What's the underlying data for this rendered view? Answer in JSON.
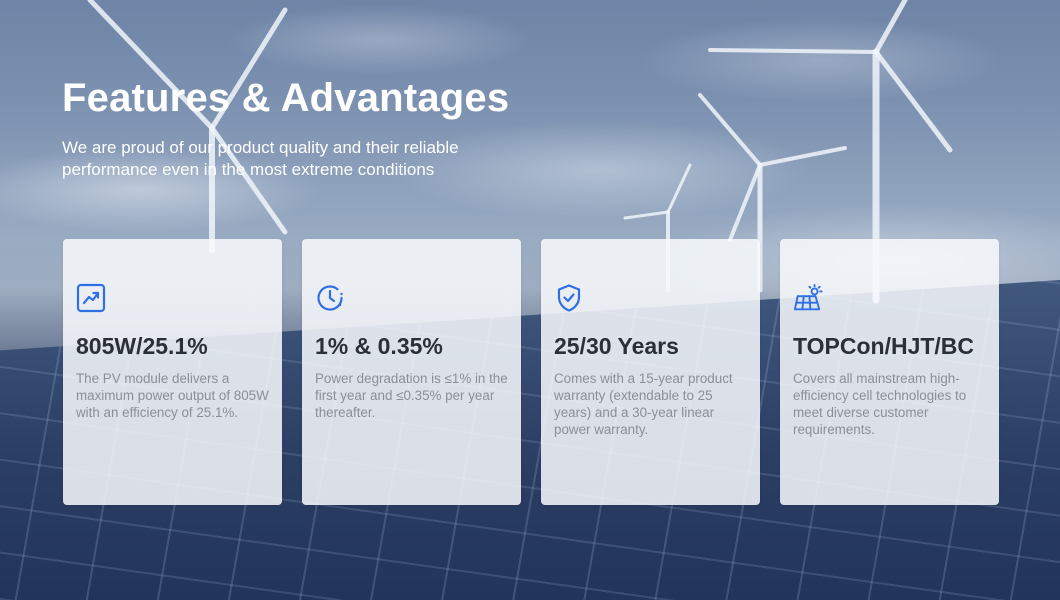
{
  "header": {
    "title": "Features & Advantages",
    "subtitle": "We are proud of our product quality and their reliable performance even in the most extreme conditions"
  },
  "theme": {
    "accent": "#2f6fe6",
    "title_color": "#2b2f36",
    "text_color": "#8a8f98"
  },
  "cards": [
    {
      "icon": "trend-chart-icon",
      "title": "805W/25.1%",
      "description": "The PV module delivers a maximum power output of 805W with an efficiency of 25.1%."
    },
    {
      "icon": "clock-icon",
      "title": "1% & 0.35%",
      "description": "Power degradation is ≤1% in the first year and ≤0.35% per year thereafter."
    },
    {
      "icon": "shield-check-icon",
      "title": "25/30 Years",
      "description": "Comes with a 15-year product warranty (extendable to 25 years) and a 30-year linear power warranty."
    },
    {
      "icon": "solar-panel-icon",
      "title": "TOPCon/HJT/BC",
      "description": "Covers all mainstream high-efficiency cell technologies to meet diverse customer requirements."
    }
  ]
}
